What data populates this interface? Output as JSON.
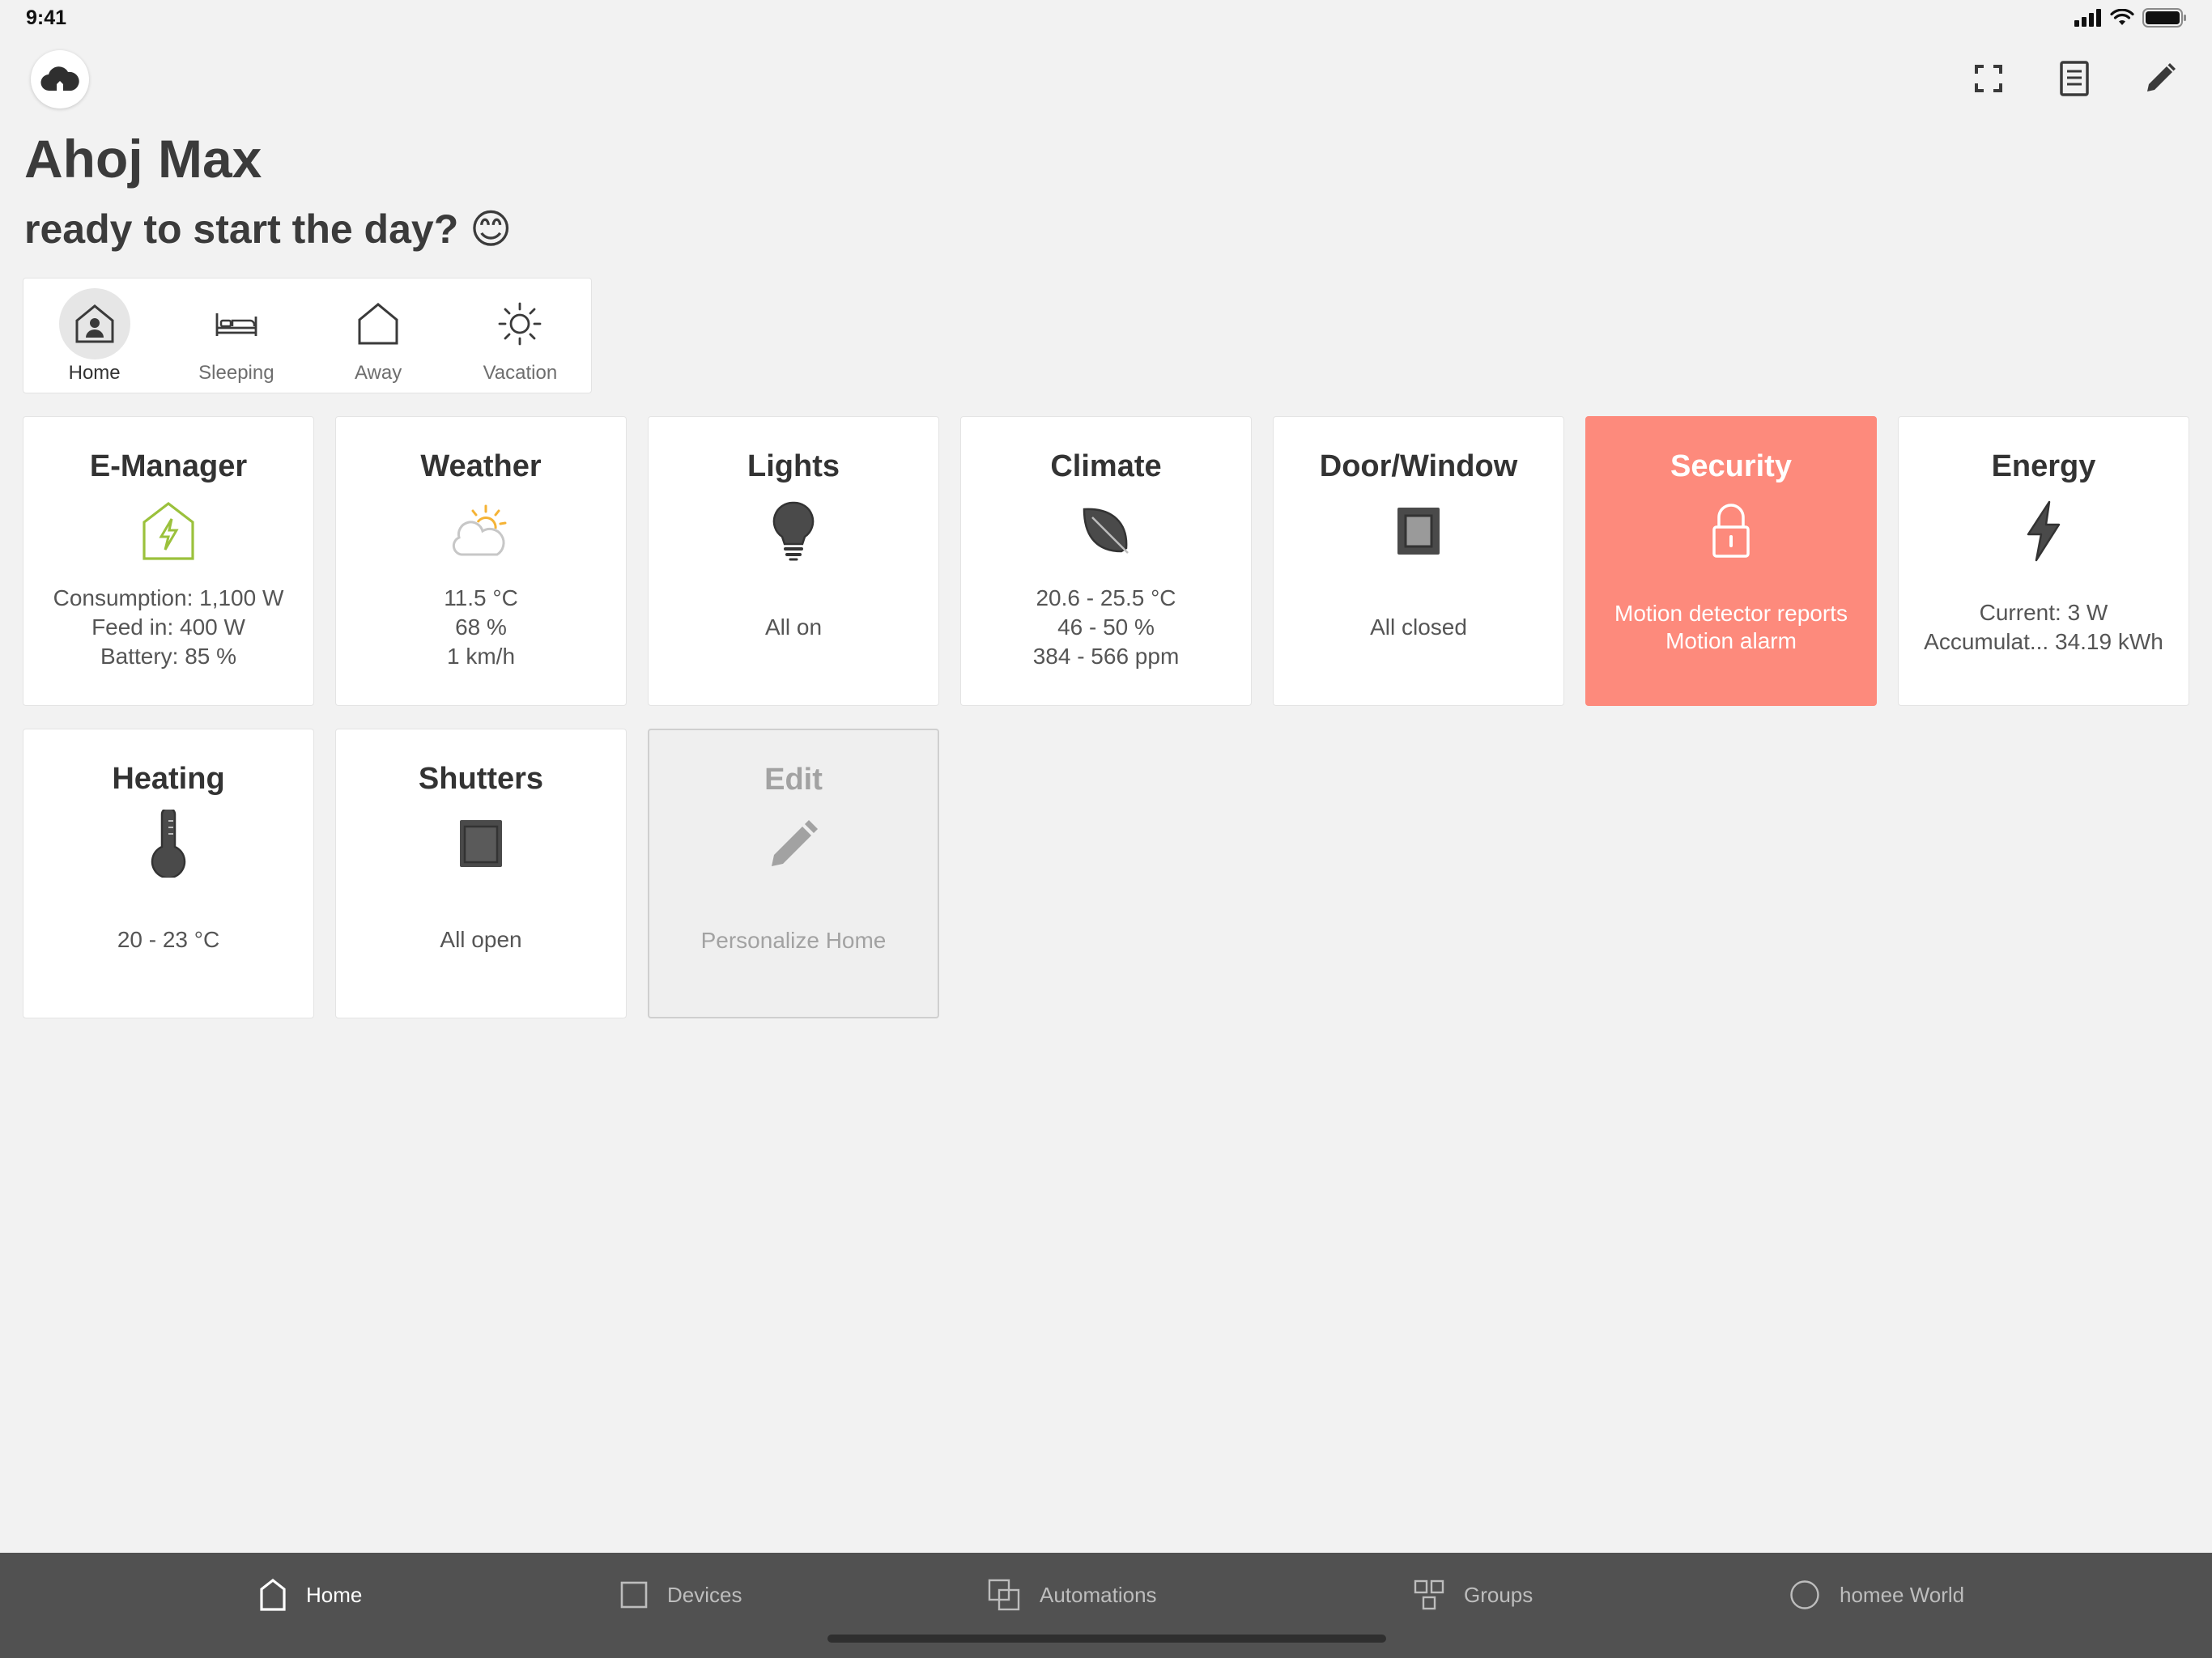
{
  "status_bar": {
    "time": "9:41"
  },
  "header": {
    "greeting": "Ahoj Max",
    "subtitle": "ready to start the day? 😊",
    "avatar_icon": "cloud-home-icon",
    "actions": [
      {
        "name": "fullscreen-icon"
      },
      {
        "name": "notes-icon"
      },
      {
        "name": "edit-pencil-icon"
      }
    ]
  },
  "modes": [
    {
      "label": "Home",
      "active": true,
      "icon": "home-person-icon"
    },
    {
      "label": "Sleeping",
      "active": false,
      "icon": "bed-icon"
    },
    {
      "label": "Away",
      "active": false,
      "icon": "house-outline-icon"
    },
    {
      "label": "Vacation",
      "active": false,
      "icon": "sun-icon"
    }
  ],
  "tiles": {
    "emanager": {
      "title": "E-Manager",
      "lines": [
        "Consumption: 1,100 W",
        "Feed in: 400 W",
        "Battery: 85 %"
      ],
      "accent": "#9bc13c"
    },
    "weather": {
      "title": "Weather",
      "lines": [
        "11.5 °C",
        "68 %",
        "1 km/h"
      ],
      "accent": "#f5b335"
    },
    "lights": {
      "title": "Lights",
      "lines": [
        "All on"
      ]
    },
    "climate": {
      "title": "Climate",
      "lines": [
        "20.6 - 25.5 °C",
        "46 - 50 %",
        "384 - 566 ppm"
      ]
    },
    "doorwindow": {
      "title": "Door/Window",
      "lines": [
        "All closed"
      ]
    },
    "security": {
      "title": "Security",
      "lines": [
        "Motion detector reports",
        "Motion alarm"
      ],
      "color": "#fd8a7c"
    },
    "energy": {
      "title": "Energy",
      "lines": [
        "Current: 3 W",
        "Accumulat... 34.19 kWh"
      ]
    },
    "heating": {
      "title": "Heating",
      "lines": [
        "20 - 23 °C"
      ]
    },
    "shutters": {
      "title": "Shutters",
      "lines": [
        "All open"
      ]
    },
    "edit": {
      "title": "Edit",
      "lines": [
        "Personalize Home"
      ]
    }
  },
  "tabbar": [
    {
      "label": "Home",
      "active": true,
      "icon": "home-tab-icon"
    },
    {
      "label": "Devices",
      "active": false,
      "icon": "devices-tab-icon"
    },
    {
      "label": "Automations",
      "active": false,
      "icon": "automations-tab-icon"
    },
    {
      "label": "Groups",
      "active": false,
      "icon": "groups-tab-icon"
    },
    {
      "label": "homee World",
      "active": false,
      "icon": "homee-world-tab-icon"
    }
  ]
}
